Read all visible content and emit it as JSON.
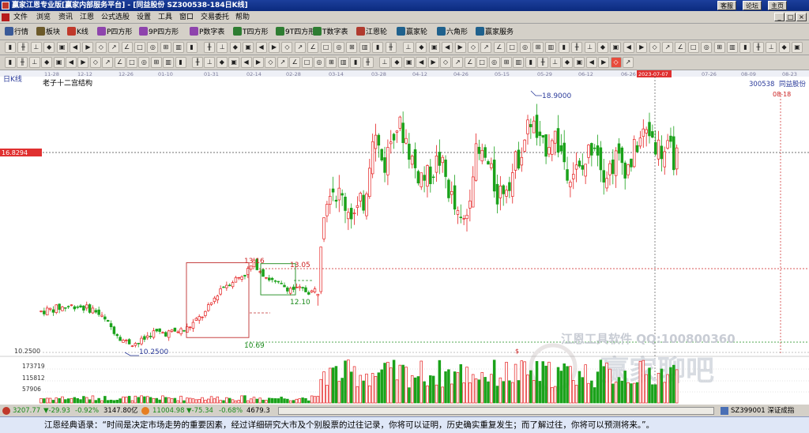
{
  "window": {
    "title": "赢家江恩专业版[赢家内部服务平台] - [同益股份   SZ300538-184日K线]",
    "title_links": [
      "客服",
      "论坛",
      "主页"
    ]
  },
  "menu": {
    "items": [
      "文件",
      "浏览",
      "资讯",
      "江恩",
      "公式选股",
      "设置",
      "工具",
      "窗口",
      "交易委托",
      "帮助"
    ],
    "window_controls": [
      "_",
      "□",
      "×"
    ]
  },
  "toolbar1": {
    "items": [
      {
        "label": "行情",
        "icon": "grid-icon",
        "color": "#3a5a98"
      },
      {
        "label": "板块",
        "icon": "blocks-icon",
        "color": "#6c5a2a"
      },
      {
        "label": "K线",
        "icon": "kline-icon",
        "color": "#c0392b"
      },
      {
        "label": "P四方形",
        "icon": "p-square-icon",
        "color": "#8e44ad"
      },
      {
        "label": "9P四方形",
        "icon": "9p-square-icon",
        "color": "#8e44ad"
      },
      {
        "label": "P数字表",
        "icon": "p-table-icon",
        "color": "#8e44ad"
      },
      {
        "label": "T四方形",
        "icon": "t-square-icon",
        "color": "#2e7d32"
      },
      {
        "label": "9T四方形",
        "icon": "9t-square-icon",
        "color": "#2e7d32"
      },
      {
        "label": "T数字表",
        "icon": "t-table-icon",
        "color": "#2e7d32"
      },
      {
        "label": "江恩轮",
        "icon": "gann-wheel-icon",
        "color": "#b03a2e"
      },
      {
        "label": "赢家轮",
        "icon": "winner-wheel-icon",
        "color": "#1f618d"
      },
      {
        "label": "六角形",
        "icon": "hexagon-icon",
        "color": "#1f618d"
      },
      {
        "label": "赢家服务",
        "icon": "service-icon",
        "color": "#1f618d"
      }
    ]
  },
  "toolbar2_icons": [
    "period-icon",
    "bars-icon",
    "ruler-icon",
    "tool-icon",
    "tool-icon",
    "tool-icon",
    "tool-icon",
    "tool-icon",
    "tool-icon",
    "tool-icon",
    "tool-icon",
    "tool-icon",
    "tool-icon",
    "tool-icon",
    "tool-icon",
    "first-icon",
    "prev-icon",
    "play-icon",
    "next-icon",
    "shrink-icon",
    "diamond-icon",
    "diamond-icon",
    "diamond-icon",
    "diamond-icon",
    "diamond-icon",
    "diamond-icon",
    "diamond-icon",
    "diamond-icon",
    "diamond-icon",
    "diamond-icon",
    "hand-icon",
    "crosshair-icon",
    "line-icon",
    "gann-fan-icon",
    "label-icon",
    "rect-icon",
    "rect-icon",
    "rect-icon",
    "rect-icon",
    "rect-icon",
    "rect-icon",
    "rect-icon",
    "rect-icon",
    "rect-icon",
    "rect-icon",
    "rect-icon",
    "rect-icon",
    "rect-icon",
    "rect-icon",
    "rect-icon",
    "rect-icon",
    "rect-icon",
    "rect-icon",
    "rect-icon",
    "rect-icon",
    "rect-icon",
    "rect-icon",
    "rect-icon",
    "rect-icon",
    "rect-icon",
    "rect-icon"
  ],
  "toolbar3_icons": [
    "period-icon",
    "bars-icon",
    "bars-icon",
    "bars-icon",
    "bars-icon",
    "bars-icon",
    "bars-icon",
    "bars-icon",
    "bars-icon",
    "bars-icon",
    "bars-icon",
    "bars-icon",
    "bars-icon",
    "bars-icon",
    "bars-icon",
    "bars-icon",
    "bars-icon",
    "bars-icon",
    "bars-icon",
    "bars-icon",
    "bars-icon",
    "bars-icon",
    "bars-icon",
    "bars-icon",
    "bars-icon",
    "bars-icon",
    "bars-icon",
    "bars-icon",
    "bars-icon",
    "bars-icon",
    "bars-icon",
    "bars-icon",
    "bars-icon",
    "bars-icon",
    "bars-icon",
    "bars-icon",
    "bars-icon",
    "bars-icon",
    "bars-icon",
    "bars-icon",
    "bars-icon",
    "bars-icon",
    "bars-icon",
    "bars-icon",
    "bars-icon",
    "bars-icon",
    "bars-icon",
    "bars-icon",
    "bars-icon",
    "color-icon",
    "infinity-icon"
  ],
  "chart": {
    "period_label": "日K线",
    "study_name": "老子十二宫结构",
    "stock_code": "300538",
    "stock_name": "同益股份",
    "date_axis": [
      "11-28",
      "12-12",
      "12-26",
      "01-10",
      "01-31",
      "02-14",
      "02-28",
      "03-14",
      "03-28",
      "04-12",
      "04-26",
      "05-15",
      "05-29",
      "06-12",
      "06-26",
      "2023-07-07",
      "07-26",
      "08-09",
      "08-23"
    ],
    "price_marker": "16.8294",
    "bottom_price": "10.2500",
    "volume_ticks": [
      "173719",
      "115812",
      "57906"
    ],
    "labels": {
      "high_peak": "18.9000",
      "target_date": "08-18",
      "box1_high": "13.16",
      "box1_low": "10.69",
      "box2_high": "13.05",
      "box2_low": "12.10",
      "low_point": "10.2500",
      "volume_flag": "$"
    },
    "watermark_software": "江恩工具软件 QQ:100800360",
    "watermark_forum": "赢家聊吧",
    "colors": {
      "up": "#e52020",
      "down": "#1aa21a",
      "box_red": "#c03030",
      "box_green": "#1a8a1a",
      "label_blue": "#2a3a9a",
      "label_red": "#cc2020",
      "current_date_bg": "#e03030"
    }
  },
  "statusbar": {
    "sh_index": "3207.77",
    "sh_change": "▼-29.93",
    "sh_pct": "-0.92%",
    "sh_amount": "3147.80亿",
    "sz_index": "11004.98",
    "sz_change": "▼-75.34",
    "sz_pct": "-0.68%",
    "sz_amount": "4679.3",
    "right_ticker": "SZ399001 深证成指"
  },
  "quote": "江恩经典语录：“时间是决定市场走势的重要因素，经过详细研究大市及个别股票的过往记录，你将可以证明，历史确实重复发生；而了解过往，你将可以预测将来。”。"
}
